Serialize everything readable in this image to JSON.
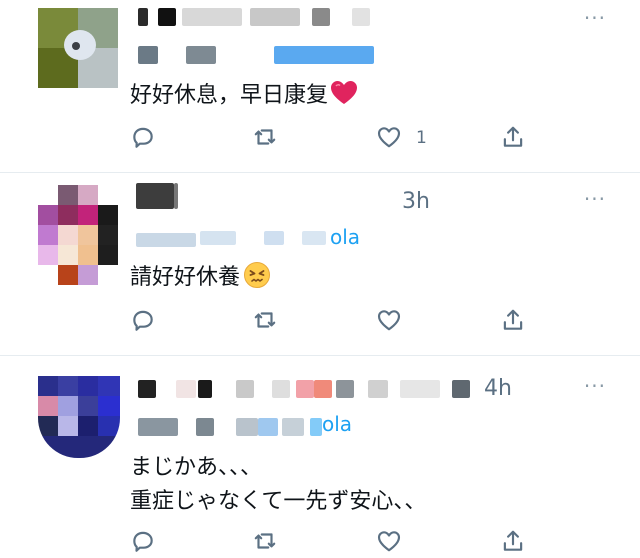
{
  "tweets": [
    {
      "text": "好好休息，早日康复",
      "emoji": "red-heart",
      "time": "",
      "handle_tail": "",
      "like_count": "1",
      "menu": "···"
    },
    {
      "text": "請好好休養",
      "emoji": "persevering-face",
      "time": "3h",
      "handle_tail": "ola",
      "like_count": "",
      "menu": "···"
    },
    {
      "text_line1": "まじかあ、、、",
      "text_line2": "重症じゃなくて一先ず安心、、",
      "time": "4h",
      "handle_tail": "ola",
      "like_count": "",
      "menu": "···"
    }
  ],
  "icons": {
    "reply": "reply-icon",
    "retweet": "retweet-icon",
    "like": "like-icon",
    "share": "share-icon"
  },
  "colors": {
    "link": "#1da1f2",
    "muted": "#5b7083",
    "divider": "#e6ecf0",
    "heart": "#e0245e"
  }
}
